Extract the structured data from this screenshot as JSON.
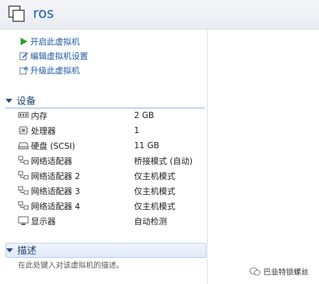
{
  "header": {
    "title": "ros"
  },
  "commands": [
    {
      "label": "开启此虚拟机",
      "icon": "play-icon"
    },
    {
      "label": "编辑虚拟机设置",
      "icon": "edit-settings-icon"
    },
    {
      "label": "升级此虚拟机",
      "icon": "upgrade-icon"
    }
  ],
  "devices_section": {
    "label": "设备"
  },
  "devices": [
    {
      "name": "内存",
      "value": "2 GB",
      "icon": "memory-icon"
    },
    {
      "name": "处理器",
      "value": "1",
      "icon": "cpu-icon"
    },
    {
      "name": "硬盘 (SCSI)",
      "value": "11 GB",
      "icon": "hard-disk-icon"
    },
    {
      "name": "网络适配器",
      "value": "桥接模式 (自动)",
      "icon": "network-adapter-icon"
    },
    {
      "name": "网络适配器 2",
      "value": "仅主机模式",
      "icon": "network-adapter-icon"
    },
    {
      "name": "网络适配器 3",
      "value": "仅主机模式",
      "icon": "network-adapter-icon"
    },
    {
      "name": "网络适配器 4",
      "value": "仅主机模式",
      "icon": "network-adapter-icon"
    },
    {
      "name": "显示器",
      "value": "自动检测",
      "icon": "monitor-icon"
    }
  ],
  "description_section": {
    "label": "描述",
    "placeholder": "在此处键入对该虚拟机的描述。"
  },
  "watermark": {
    "text": "巴韭特锁螺丝"
  }
}
